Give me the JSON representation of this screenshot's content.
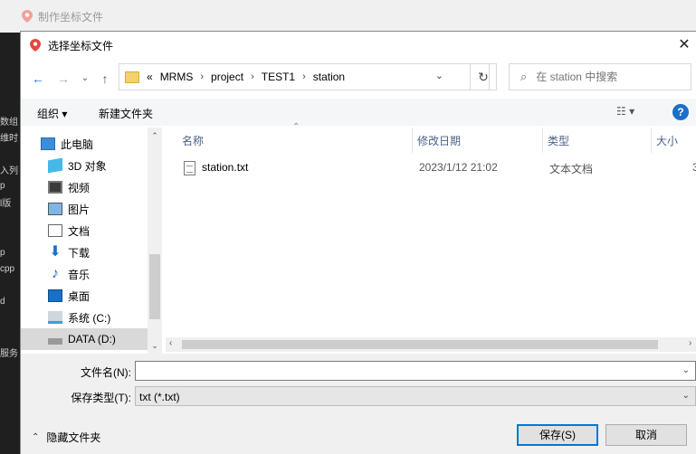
{
  "parent_window": {
    "title": "制作坐标文件"
  },
  "background_fragments": [
    "数组",
    "维时",
    "入列",
    "p",
    "l版",
    "p",
    "cpp",
    "d",
    "服务"
  ],
  "dialog": {
    "title": "选择坐标文件",
    "close_glyph": "✕"
  },
  "address_bar": {
    "overflow": "«",
    "breadcrumbs": [
      "MRMS",
      "project",
      "TEST1",
      "station"
    ]
  },
  "search": {
    "placeholder": "在 station 中搜索"
  },
  "toolbar": {
    "organize": "组织 ▾",
    "new_folder": "新建文件夹",
    "view_glyph": "☷ ▾",
    "help": "?"
  },
  "nav_pane": {
    "items": [
      {
        "label": "此电脑",
        "icon": "computer-icon"
      },
      {
        "label": "3D 对象",
        "icon": "3d-objects-icon"
      },
      {
        "label": "视频",
        "icon": "video-icon"
      },
      {
        "label": "图片",
        "icon": "pictures-icon"
      },
      {
        "label": "文档",
        "icon": "documents-icon"
      },
      {
        "label": "下载",
        "icon": "downloads-icon"
      },
      {
        "label": "音乐",
        "icon": "music-icon"
      },
      {
        "label": "桌面",
        "icon": "desktop-icon"
      },
      {
        "label": "系统 (C:)",
        "icon": "drive-c-icon"
      },
      {
        "label": "DATA (D:)",
        "icon": "drive-d-icon"
      }
    ],
    "selected": "DATA (D:)"
  },
  "file_list": {
    "columns": [
      "名称",
      "修改日期",
      "类型",
      "大小"
    ],
    "rows": [
      {
        "name": "station.txt",
        "modified": "2023/1/12 21:02",
        "type": "文本文档",
        "size": "3"
      }
    ]
  },
  "form": {
    "filename_label": "文件名(N):",
    "filename_value": "",
    "filetype_label": "保存类型(T):",
    "filetype_value": "txt (*.txt)"
  },
  "footer": {
    "hide_folders": "隐藏文件夹",
    "save": "保存(S)",
    "cancel": "取消"
  },
  "colors": {
    "accent": "#0078d7",
    "header_text": "#4d6185",
    "pin": "#e8453c"
  }
}
